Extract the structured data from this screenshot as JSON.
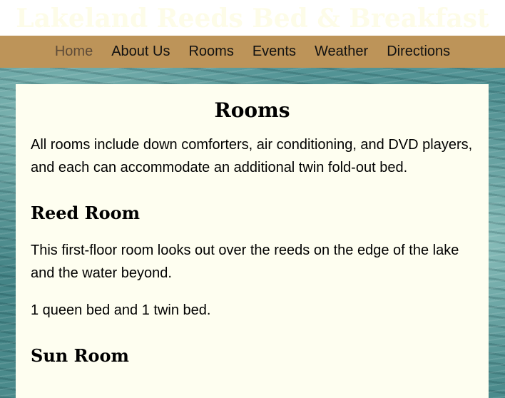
{
  "site": {
    "title": "Lakeland Reeds Bed & Breakfast"
  },
  "nav": {
    "items": [
      "Home",
      "About Us",
      "Rooms",
      "Events",
      "Weather",
      "Directions"
    ]
  },
  "page": {
    "title": "Rooms",
    "intro": "All rooms include down comforters, air conditioning, and DVD players, and each can accommodate an additional twin fold-out bed."
  },
  "rooms": [
    {
      "name": "Reed Room",
      "description": "This first-floor room looks out over the reeds on the edge of the lake and the water beyond.",
      "beds": "1 queen bed and 1 twin bed."
    },
    {
      "name": "Sun Room"
    }
  ],
  "colors": {
    "title_text": "#fdfce8",
    "nav_background": "#bd9459",
    "nav_current": "#5e4b38",
    "content_background": "#fefef0"
  }
}
